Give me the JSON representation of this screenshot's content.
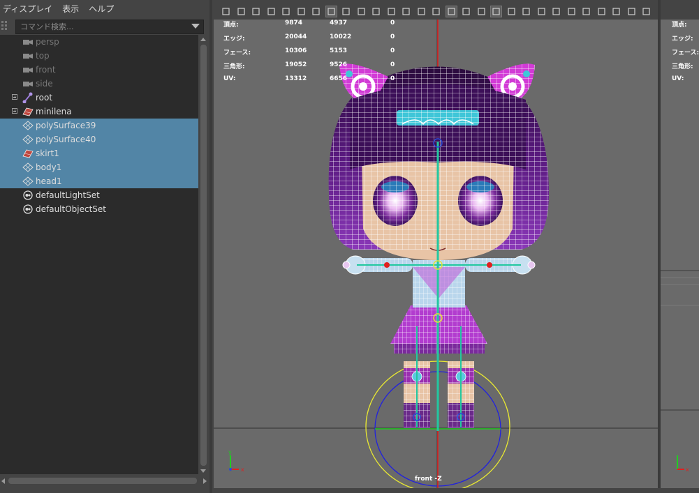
{
  "outliner": {
    "menu": [
      "ディスプレイ",
      "表示",
      "ヘルプ"
    ],
    "search_placeholder": "コマンド検索...",
    "items": [
      {
        "label": "persp",
        "icon": "camera-icon",
        "dim": true,
        "selected": false,
        "expandable": false
      },
      {
        "label": "top",
        "icon": "camera-icon",
        "dim": true,
        "selected": false,
        "expandable": false
      },
      {
        "label": "front",
        "icon": "camera-icon",
        "dim": true,
        "selected": false,
        "expandable": false
      },
      {
        "label": "side",
        "icon": "camera-icon",
        "dim": true,
        "selected": false,
        "expandable": false
      },
      {
        "label": "root",
        "icon": "joint-icon",
        "dim": false,
        "selected": false,
        "expandable": true
      },
      {
        "label": "minilena",
        "icon": "mesh-icon",
        "dim": false,
        "selected": false,
        "expandable": true
      },
      {
        "label": "polySurface39",
        "icon": "poly-icon",
        "dim": false,
        "selected": true,
        "expandable": false
      },
      {
        "label": "polySurface40",
        "icon": "poly-icon",
        "dim": false,
        "selected": true,
        "expandable": false
      },
      {
        "label": "skirt1",
        "icon": "mesh-icon",
        "dim": false,
        "selected": true,
        "expandable": false
      },
      {
        "label": "body1",
        "icon": "poly-icon",
        "dim": false,
        "selected": true,
        "expandable": false
      },
      {
        "label": "head1",
        "icon": "poly-icon",
        "dim": false,
        "selected": true,
        "expandable": false
      },
      {
        "label": "defaultLightSet",
        "icon": "set-icon",
        "dim": false,
        "selected": false,
        "expandable": false
      },
      {
        "label": "defaultObjectSet",
        "icon": "set-icon",
        "dim": false,
        "selected": false,
        "expandable": false
      }
    ]
  },
  "viewport": {
    "hud": [
      {
        "label": "頂点:",
        "v1": "9874",
        "v2": "4937",
        "v3": "0"
      },
      {
        "label": "エッジ:",
        "v1": "20044",
        "v2": "10022",
        "v3": "0"
      },
      {
        "label": "フェース:",
        "v1": "10306",
        "v2": "5153",
        "v3": "0"
      },
      {
        "label": "三角形:",
        "v1": "19052",
        "v2": "9526",
        "v3": "0"
      },
      {
        "label": "UV:",
        "v1": "13312",
        "v2": "6656",
        "v3": "0"
      }
    ],
    "camera_label": "front -Z"
  },
  "right_panel": {
    "hud_labels": [
      "頂点:",
      "エッジ:",
      "フェース:",
      "三角形:",
      "UV:"
    ]
  },
  "colors": {
    "selection": "#5285a6",
    "viewport_bg": "#6a6a6a",
    "wire": "#ffffff",
    "hair": "#6a1c8e",
    "ears": "#d23bd6",
    "skin": "#e8c4a6",
    "accent_cyan": "#3fc6d8"
  }
}
